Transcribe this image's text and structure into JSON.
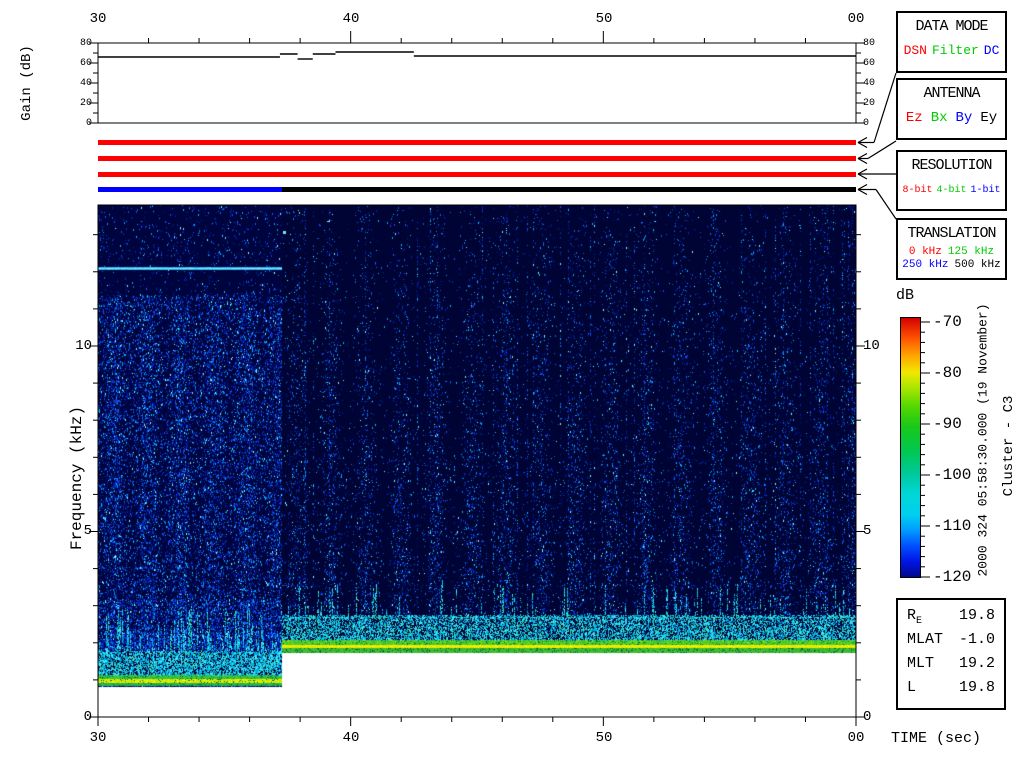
{
  "time_axis": {
    "label": "TIME (sec)",
    "tick_labels": [
      "30",
      "40",
      "50",
      "00"
    ]
  },
  "gain_plot": {
    "ylabel": "Gain (dB)",
    "ytick_labels": [
      "80",
      "60",
      "40",
      "20",
      "0"
    ]
  },
  "spectrogram": {
    "ylabel": "Frequency (kHz)",
    "ytick_labels": [
      "10",
      "5",
      "0"
    ]
  },
  "colorbar": {
    "label": "dB",
    "tick_labels": [
      "-70",
      "-80",
      "-90",
      "-100",
      "-110",
      "-120"
    ],
    "gradient": [
      [
        0,
        "#d40000"
      ],
      [
        0.08,
        "#ff5500"
      ],
      [
        0.15,
        "#ffaa00"
      ],
      [
        0.21,
        "#f0e800"
      ],
      [
        0.27,
        "#aae600"
      ],
      [
        0.34,
        "#55d800"
      ],
      [
        0.42,
        "#19c819"
      ],
      [
        0.52,
        "#00c855"
      ],
      [
        0.6,
        "#00c89b"
      ],
      [
        0.68,
        "#00d7d7"
      ],
      [
        0.76,
        "#00cff0"
      ],
      [
        0.82,
        "#009bff"
      ],
      [
        0.88,
        "#0050ff"
      ],
      [
        0.94,
        "#0014e6"
      ],
      [
        1,
        "#000a8c"
      ]
    ]
  },
  "panels": {
    "data_mode": {
      "title": "DATA MODE",
      "items": [
        {
          "label": "DSN",
          "color": "#ff0000"
        },
        {
          "label": "Filter",
          "color": "#00cc00"
        },
        {
          "label": "DC",
          "color": "#0000ff"
        }
      ]
    },
    "antenna": {
      "title": "ANTENNA",
      "items": [
        {
          "label": "Ez",
          "color": "#ff0000"
        },
        {
          "label": "Bx",
          "color": "#00cc00"
        },
        {
          "label": "By",
          "color": "#0000ff"
        },
        {
          "label": "Ey",
          "color": "#000000"
        }
      ]
    },
    "resolution": {
      "title": "RESOLUTION",
      "items": [
        {
          "label": "8-bit",
          "color": "#ff0000"
        },
        {
          "label": "4-bit",
          "color": "#00cc00"
        },
        {
          "label": "1-bit",
          "color": "#0000ff"
        }
      ]
    },
    "translation": {
      "title": "TRANSLATION",
      "rows": [
        [
          {
            "label": "0 kHz",
            "color": "#ff0000"
          },
          {
            "label": "125 kHz",
            "color": "#00cc00"
          }
        ],
        [
          {
            "label": "250 kHz",
            "color": "#0000ff"
          },
          {
            "label": "500 kHz",
            "color": "#000000"
          }
        ]
      ]
    }
  },
  "status_bars": [
    {
      "name": "data-mode-bar",
      "segments": [
        {
          "t0": 30,
          "t1": 60,
          "color": "#ff0000"
        }
      ]
    },
    {
      "name": "antenna-bar",
      "segments": [
        {
          "t0": 30,
          "t1": 60,
          "color": "#ff0000"
        }
      ]
    },
    {
      "name": "resolution-bar",
      "segments": [
        {
          "t0": 30,
          "t1": 60,
          "color": "#ff0000"
        }
      ]
    },
    {
      "name": "translation-bar",
      "segments": [
        {
          "t0": 30,
          "t1": 37.28,
          "color": "#0000ff"
        },
        {
          "t0": 37.28,
          "t1": 60,
          "color": "#000000"
        }
      ]
    }
  ],
  "annotation": {
    "datetime": "2000 324 05:58:30.000 (19 November)",
    "spacecraft": "Cluster - C3"
  },
  "ephemeris": {
    "rows": [
      {
        "label": "R",
        "sub": "E",
        "value": "19.8"
      },
      {
        "label": "MLAT",
        "sub": "",
        "value": "-1.0"
      },
      {
        "label": "MLT",
        "sub": "",
        "value": "19.2"
      },
      {
        "label": "L",
        "sub": "",
        "value": "19.8"
      }
    ]
  },
  "chart_data": [
    {
      "type": "line",
      "name": "agc-gain",
      "title": "Receiver AGC gain vs time",
      "xlabel": "TIME (sec)",
      "ylabel": "Gain (dB)",
      "xlim_sec": [
        30,
        60
      ],
      "ylim": [
        0,
        80
      ],
      "x_tick_labels": [
        "30",
        "40",
        "50",
        "00"
      ],
      "x_minor_step_sec": 2,
      "y_ticks_major": [
        0,
        20,
        40,
        60,
        80
      ],
      "y_ticks_minor": [
        10,
        30,
        50,
        70
      ],
      "series": [
        {
          "name": "gain-steps",
          "segments": [
            [
              30,
              37.2,
              66
            ],
            [
              37.2,
              37.9,
              69
            ],
            [
              37.9,
              38.5,
              64
            ],
            [
              38.5,
              39.4,
              69
            ],
            [
              39.4,
              42.5,
              71
            ],
            [
              42.5,
              60,
              67
            ]
          ]
        }
      ]
    },
    {
      "type": "heatmap",
      "name": "wideband-spectrogram",
      "xlabel": "TIME (sec)",
      "ylabel": "Frequency (kHz)",
      "xlim_sec": [
        30,
        60
      ],
      "ylim_khz": [
        0,
        13.8
      ],
      "y_ticks_major_khz": [
        0,
        5,
        10
      ],
      "colorbar_db": {
        "min": -120,
        "max": -70,
        "major_step": 10,
        "minor_step": 2
      },
      "segments": [
        {
          "name": "segment-250khz-8bit",
          "t0": 30,
          "t1": 37.28,
          "f_min": 0.8,
          "tone_line_khz": 12.1,
          "striation_period_sec": 1.3,
          "bands": [
            {
              "f0": 0.85,
              "f1": 1.15,
              "level": "strong",
              "color": "yellow-green"
            },
            {
              "f0": 1.15,
              "f1": 1.8,
              "level": "moderate",
              "color": "cyan"
            }
          ]
        },
        {
          "name": "segment-500khz-1bit",
          "t0": 37.28,
          "t1": 60,
          "f_min": 1.73,
          "striation_period_sec": 1.4,
          "bands": [
            {
              "f0": 1.78,
              "f1": 2.08,
              "level": "strong",
              "color": "yellow-green"
            },
            {
              "f0": 2.08,
              "f1": 2.75,
              "level": "moderate",
              "color": "cyan"
            }
          ]
        }
      ]
    }
  ]
}
